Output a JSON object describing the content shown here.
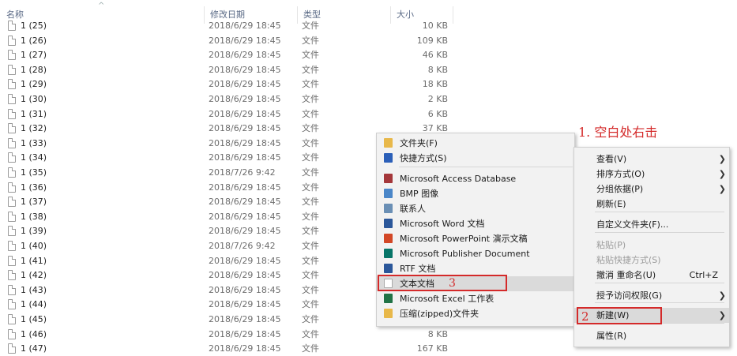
{
  "header": {
    "col_name": "名称",
    "col_date": "修改日期",
    "col_type": "类型",
    "col_size": "大小",
    "sort_glyph": "^"
  },
  "files": [
    {
      "name": "1 (25)",
      "date": "2018/6/29 18:45",
      "type": "文件",
      "size": "10 KB"
    },
    {
      "name": "1 (26)",
      "date": "2018/6/29 18:45",
      "type": "文件",
      "size": "109 KB"
    },
    {
      "name": "1 (27)",
      "date": "2018/6/29 18:45",
      "type": "文件",
      "size": "46 KB"
    },
    {
      "name": "1 (28)",
      "date": "2018/6/29 18:45",
      "type": "文件",
      "size": "8 KB"
    },
    {
      "name": "1 (29)",
      "date": "2018/6/29 18:45",
      "type": "文件",
      "size": "18 KB"
    },
    {
      "name": "1 (30)",
      "date": "2018/6/29 18:45",
      "type": "文件",
      "size": "2 KB"
    },
    {
      "name": "1 (31)",
      "date": "2018/6/29 18:45",
      "type": "文件",
      "size": "6 KB"
    },
    {
      "name": "1 (32)",
      "date": "2018/6/29 18:45",
      "type": "文件",
      "size": "37 KB"
    },
    {
      "name": "1 (33)",
      "date": "2018/6/29 18:45",
      "type": "文件",
      "size": ""
    },
    {
      "name": "1 (34)",
      "date": "2018/6/29 18:45",
      "type": "文件",
      "size": ""
    },
    {
      "name": "1 (35)",
      "date": "2018/7/26 9:42",
      "type": "文件",
      "size": ""
    },
    {
      "name": "1 (36)",
      "date": "2018/6/29 18:45",
      "type": "文件",
      "size": ""
    },
    {
      "name": "1 (37)",
      "date": "2018/6/29 18:45",
      "type": "文件",
      "size": ""
    },
    {
      "name": "1 (38)",
      "date": "2018/6/29 18:45",
      "type": "文件",
      "size": ""
    },
    {
      "name": "1 (39)",
      "date": "2018/6/29 18:45",
      "type": "文件",
      "size": ""
    },
    {
      "name": "1 (40)",
      "date": "2018/7/26 9:42",
      "type": "文件",
      "size": ""
    },
    {
      "name": "1 (41)",
      "date": "2018/6/29 18:45",
      "type": "文件",
      "size": ""
    },
    {
      "name": "1 (42)",
      "date": "2018/6/29 18:45",
      "type": "文件",
      "size": ""
    },
    {
      "name": "1 (43)",
      "date": "2018/6/29 18:45",
      "type": "文件",
      "size": ""
    },
    {
      "name": "1 (44)",
      "date": "2018/6/29 18:45",
      "type": "文件",
      "size": ""
    },
    {
      "name": "1 (45)",
      "date": "2018/6/29 18:45",
      "type": "文件",
      "size": ""
    },
    {
      "name": "1 (46)",
      "date": "2018/6/29 18:45",
      "type": "文件",
      "size": "8 KB"
    },
    {
      "name": "1 (47)",
      "date": "2018/6/29 18:45",
      "type": "文件",
      "size": "167 KB"
    }
  ],
  "context_menu": {
    "items": [
      {
        "label": "查看(V)",
        "submenu": true
      },
      {
        "label": "排序方式(O)",
        "submenu": true
      },
      {
        "label": "分组依据(P)",
        "submenu": true
      },
      {
        "label": "刷新(E)"
      },
      {
        "label": "自定义文件夹(F)..."
      },
      {
        "label": "粘贴(P)",
        "disabled": true
      },
      {
        "label": "粘贴快捷方式(S)",
        "disabled": true
      },
      {
        "label": "撤消 重命名(U)",
        "shortcut": "Ctrl+Z"
      },
      {
        "label": "授予访问权限(G)",
        "submenu": true
      },
      {
        "label": "新建(W)",
        "submenu": true,
        "highlighted": true
      },
      {
        "label": "属性(R)"
      }
    ]
  },
  "new_menu": {
    "items": [
      {
        "label": "文件夹(F)",
        "icon": "folder-icon",
        "color": "#e8b84a"
      },
      {
        "label": "快捷方式(S)",
        "icon": "shortcut-icon",
        "color": "#2b5fb8"
      },
      {
        "label": "Microsoft Access Database",
        "icon": "access-icon",
        "color": "#a4373a"
      },
      {
        "label": "BMP 图像",
        "icon": "bmp-icon",
        "color": "#4a86c8"
      },
      {
        "label": "联系人",
        "icon": "contact-icon",
        "color": "#6a8fb5"
      },
      {
        "label": "Microsoft Word 文档",
        "icon": "word-icon",
        "color": "#2b579a"
      },
      {
        "label": "Microsoft PowerPoint 演示文稿",
        "icon": "powerpoint-icon",
        "color": "#d24726"
      },
      {
        "label": "Microsoft Publisher Document",
        "icon": "publisher-icon",
        "color": "#077568"
      },
      {
        "label": "RTF 文档",
        "icon": "rtf-icon",
        "color": "#2b579a"
      },
      {
        "label": "文本文档",
        "icon": "text-doc-icon",
        "color": "#ffffff",
        "highlighted": true
      },
      {
        "label": "Microsoft Excel 工作表",
        "icon": "excel-icon",
        "color": "#217346"
      },
      {
        "label": "压缩(zipped)文件夹",
        "icon": "zip-folder-icon",
        "color": "#e8b84a"
      }
    ]
  },
  "annotations": {
    "step1": "1. 空白处右击",
    "step2": "2",
    "step3": "3",
    "color": "#d42a2a"
  }
}
